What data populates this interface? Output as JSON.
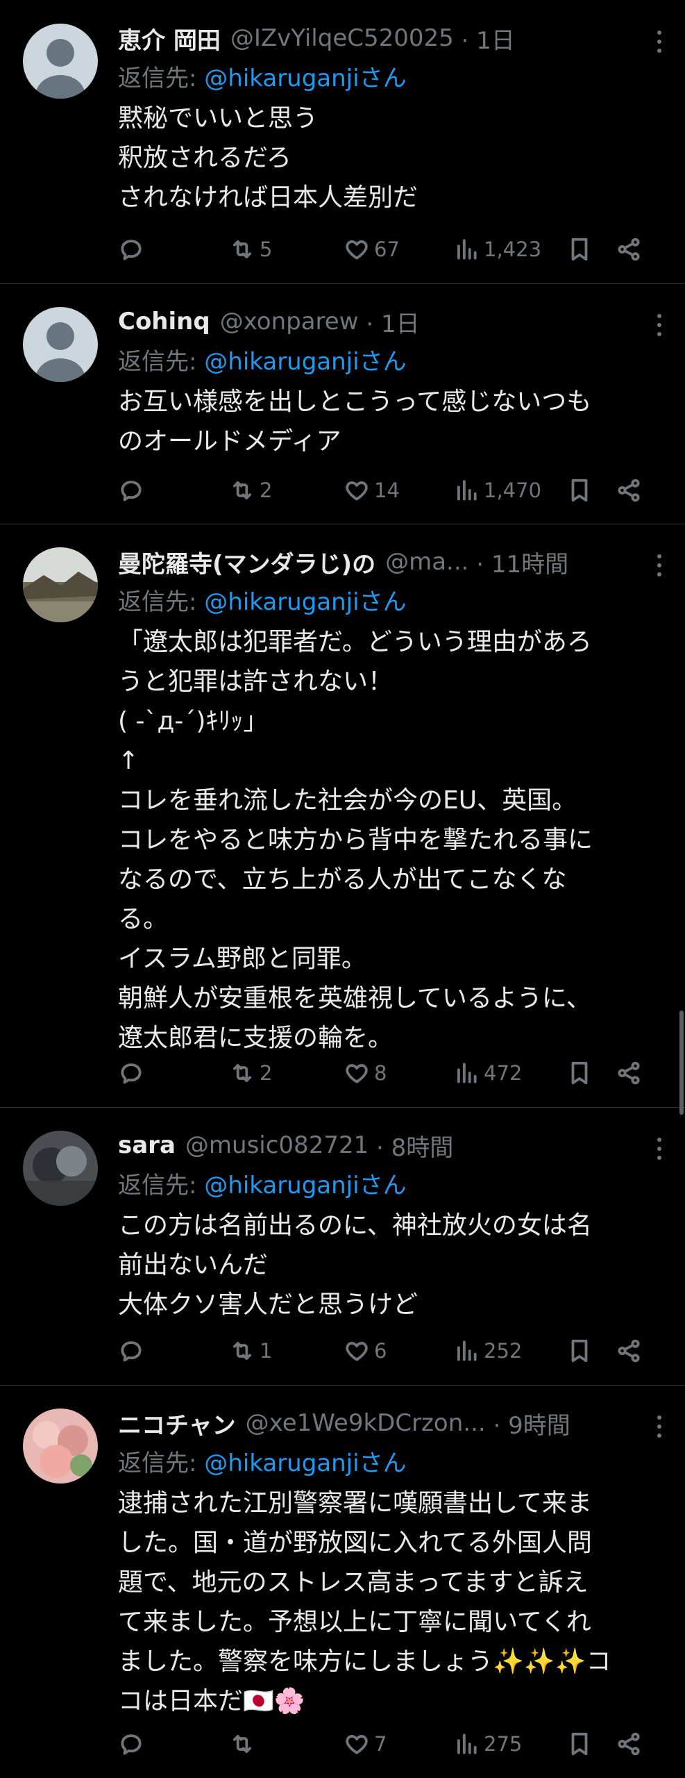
{
  "tweets": [
    {
      "name": "恵介 岡田",
      "handle": "@IZvYilqeC520025",
      "time": " · 1日",
      "reply_prefix": "返信先: ",
      "reply_mention": "@hikaruganjiさん",
      "body": "黙秘でいいと思う\n釈放されるだろ\nされなければ日本人差別だ",
      "replies": "",
      "retweets": "5",
      "likes": "67",
      "views": "1,423",
      "avatar": "default-avatar"
    },
    {
      "name": "Cohinq",
      "handle": "@xonparew",
      "time": " · 1日",
      "reply_prefix": "返信先: ",
      "reply_mention": "@hikaruganjiさん",
      "body": "お互い様感を出しとこうって感じないつも\nのオールドメディア",
      "replies": "",
      "retweets": "2",
      "likes": "14",
      "views": "1,470",
      "avatar": "default-avatar"
    },
    {
      "name": "曼陀羅寺(マンダラじ)の",
      "handle": "@ma...",
      "time": " · 11時間",
      "reply_prefix": "返信先: ",
      "reply_mention": "@hikaruganjiさん",
      "body": "「遼太郎は犯罪者だ。どういう理由があろ\nうと犯罪は許されない！\n( -`д-´)ｷﾘｯ」\n↑\nコレを垂れ流した社会が今のEU、英国。\nコレをやると味方から背中を撃たれる事に\nなるので、立ち上がる人が出てこなくな\nる。\nイスラム野郎と同罪。\n朝鮮人が安重根を英雄視しているように、\n遼太郎君に支援の輪を。",
      "replies": "",
      "retweets": "2",
      "likes": "8",
      "views": "472",
      "avatar": "landscape-avatar"
    },
    {
      "name": "sara",
      "handle": "@music082721",
      "time": " · 8時間",
      "reply_prefix": "返信先: ",
      "reply_mention": "@hikaruganjiさん",
      "body": "この方は名前出るのに、神社放火の女は名\n前出ないんだ\n大体クソ害人だと思うけど",
      "replies": "",
      "retweets": "1",
      "likes": "6",
      "views": "252",
      "avatar": "photo-avatar"
    },
    {
      "name": "ニコチャン",
      "handle": "@xe1We9kDCrzon...",
      "time": " · 9時間",
      "reply_prefix": "返信先: ",
      "reply_mention": "@hikaruganjiさん",
      "body": "逮捕された江別警察署に嘆願書出して来ま\nした。国・道が野放図に入れてる外国人問\n題で、地元のストレス高まってますと訴え\nて来ました。予想以上に丁寧に聞いてくれ\nました。警察を味方にしましょう✨✨✨コ\nコは日本だ🇯🇵🌸",
      "replies": "",
      "retweets": "",
      "likes": "7",
      "views": "275",
      "avatar": "flower-avatar"
    }
  ],
  "colors": {
    "background": "#000000",
    "text": "#e7e9ea",
    "muted": "#71767b",
    "link": "#1d9bf0",
    "divider": "#2f3336"
  },
  "icons": [
    "reply-icon",
    "retweet-icon",
    "like-icon",
    "views-icon",
    "bookmark-icon",
    "share-icon",
    "more-icon"
  ]
}
